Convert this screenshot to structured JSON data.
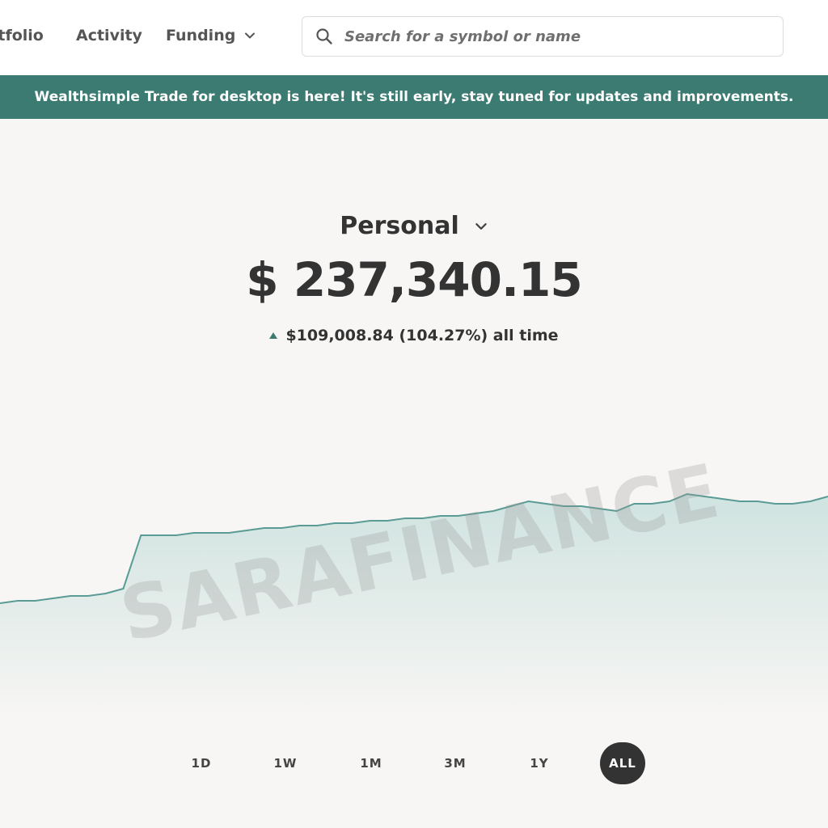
{
  "nav": {
    "portfolio": "rtfolio",
    "activity": "Activity",
    "funding": "Funding"
  },
  "search": {
    "placeholder": "Search for a symbol or name"
  },
  "banner": {
    "text": "Wealthsimple Trade for desktop is here! It's still early, stay tuned for updates and improvements."
  },
  "account": {
    "name": "Personal",
    "balance": "$ 237,340.15",
    "gain": "$109,008.84 (104.27%) all time"
  },
  "watermark": "SARAFINANCE",
  "ranges": [
    {
      "label": "1D",
      "active": false
    },
    {
      "label": "1W",
      "active": false
    },
    {
      "label": "1M",
      "active": false
    },
    {
      "label": "3M",
      "active": false
    },
    {
      "label": "1Y",
      "active": false
    },
    {
      "label": "ALL",
      "active": true
    }
  ],
  "colors": {
    "accent": "#3b7b72",
    "line": "#5a9c95"
  },
  "chart_data": {
    "type": "area",
    "values": [
      128,
      129,
      129,
      130,
      131,
      131,
      132,
      134,
      156,
      156,
      156,
      157,
      157,
      157,
      158,
      159,
      159,
      160,
      160,
      161,
      161,
      162,
      162,
      163,
      163,
      164,
      164,
      165,
      166,
      168,
      170,
      169,
      168,
      168,
      167,
      166,
      169,
      169,
      170,
      173,
      172,
      171,
      170,
      170,
      169,
      169,
      170,
      172
    ]
  }
}
